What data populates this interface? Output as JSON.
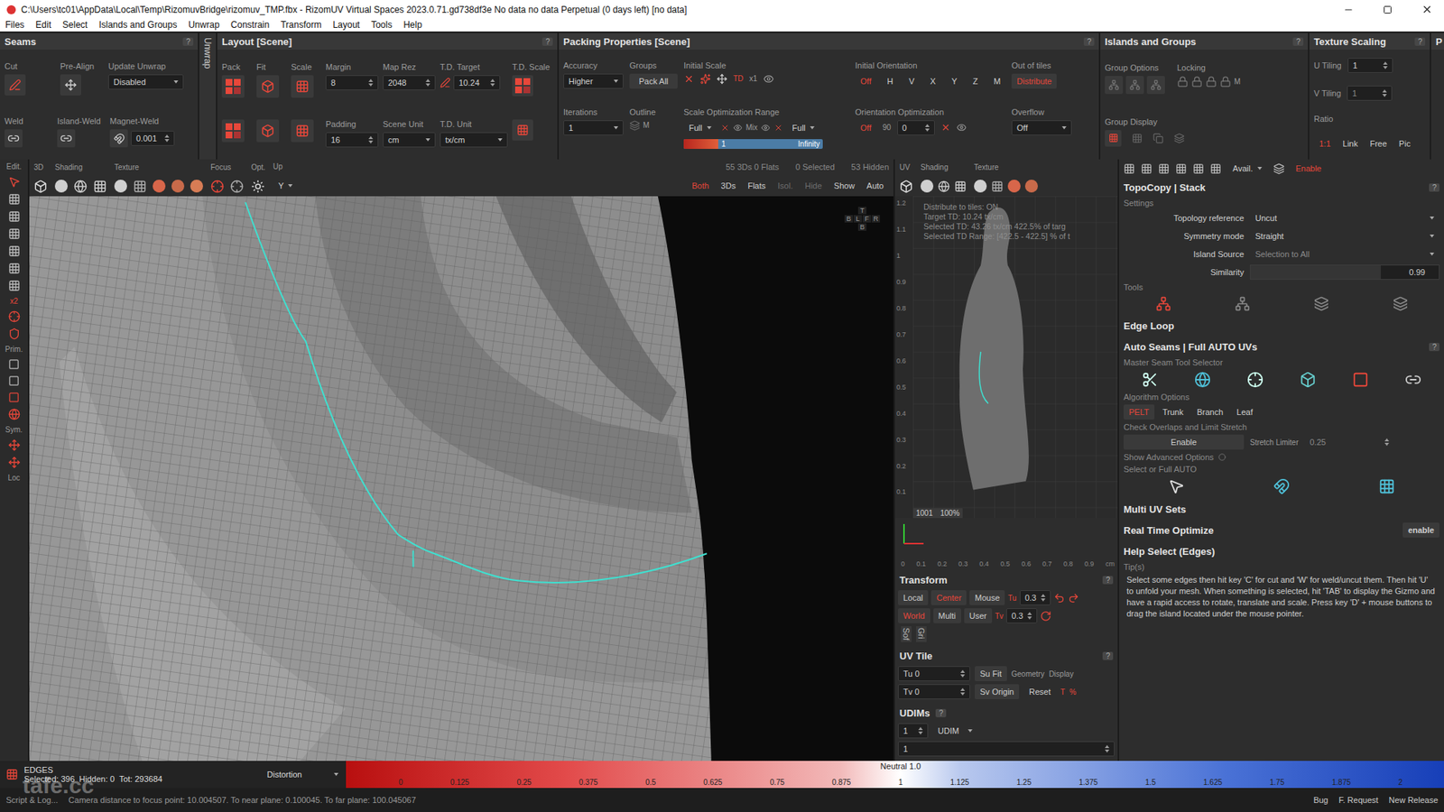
{
  "window": {
    "title": "C:\\Users\\tc01\\AppData\\Local\\Temp\\RizomuvBridge\\rizomuv_TMP.fbx - RizomUV  Virtual Spaces 2023.0.71.gd738df3e No data no data Perpetual  (0 days left) [no data]"
  },
  "menu": [
    "Files",
    "Edit",
    "Select",
    "Islands and Groups",
    "Unwrap",
    "Constrain",
    "Transform",
    "Layout",
    "Tools",
    "Help"
  ],
  "seams": {
    "title": "Seams",
    "help": "?",
    "cut": "Cut",
    "preAlign": "Pre-Align",
    "updateUnwrap": "Update Unwrap",
    "updateValue": "Disabled",
    "weld": "Weld",
    "islandWeld": "Island-Weld",
    "magnetWeld": "Magnet-Weld",
    "magnetValue": "0.001"
  },
  "unwrapTab": "Unwrap",
  "layout": {
    "title": "Layout [Scene]",
    "help": "?",
    "pack": "Pack",
    "fit": "Fit",
    "scale": "Scale",
    "margin": {
      "label": "Margin",
      "value": "8"
    },
    "mapRez": {
      "label": "Map Rez",
      "value": "2048"
    },
    "tdTarget": {
      "label": "T.D. Target",
      "value": "10.24"
    },
    "tdScale": "T.D. Scale",
    "padding": {
      "label": "Padding",
      "value": "16"
    },
    "sceneUnit": {
      "label": "Scene Unit",
      "value": "cm"
    },
    "tdUnit": {
      "label": "T.D. Unit",
      "value": "tx/cm"
    }
  },
  "packing": {
    "title": "Packing Properties [Scene]",
    "help": "?",
    "accuracy": {
      "label": "Accuracy",
      "value": "Higher"
    },
    "groups": {
      "label": "Groups",
      "value": "Pack All"
    },
    "initialScale": {
      "label": "Initial Scale",
      "value": "x1"
    },
    "iterations": {
      "label": "Iterations",
      "value": "1"
    },
    "outline": {
      "label": "Outline",
      "value": "M"
    },
    "scaleRange": {
      "label": "Scale Optimization Range",
      "min": "Full",
      "mix": "Mix",
      "max": "Full",
      "low": "1",
      "high": "Infinity",
      "level": 0.5
    },
    "initialOrientation": {
      "label": "Initial Orientation",
      "off": "Off",
      "axes": [
        "H",
        "V",
        "X",
        "Y",
        "Z",
        "M"
      ]
    },
    "orientationOpt": {
      "label": "Orientation Optimization",
      "off": "Off",
      "step": "90",
      "value": "0"
    },
    "outOfTiles": {
      "label": "Out of tiles",
      "value": "Distribute"
    },
    "overflow": {
      "label": "Overflow",
      "value": "Off"
    }
  },
  "islands": {
    "title": "Islands and Groups",
    "help": "?",
    "groupOptions": "Group Options",
    "locking": "Locking",
    "lockM": "M",
    "groupDisplay": "Group Display"
  },
  "texScaling": {
    "title": "Texture Scaling",
    "help": "?",
    "uTiling": {
      "label": "U Tiling",
      "value": "1"
    },
    "vTiling": {
      "label": "V Tiling",
      "value": "1"
    },
    "ratio": {
      "label": "Ratio",
      "options": [
        {
          "label": "1:1",
          "selected": true
        },
        {
          "label": "Link",
          "selected": false
        },
        {
          "label": "Free",
          "selected": false
        },
        {
          "label": "Pic",
          "selected": false
        }
      ]
    }
  },
  "cutPanel": "P",
  "leftToolbar": {
    "edit": "Edit.",
    "x2": "x2",
    "prim": "Prim.",
    "sym": "Sym.",
    "loc": "Loc"
  },
  "viewport": {
    "labels": [
      "3D",
      "Shading",
      "Texture",
      "Focus",
      "Opt.",
      "Up"
    ],
    "upValue": "Y",
    "stats": [
      "55 3Ds 0 Flats",
      "0 Selected",
      "53 Hidden"
    ],
    "buttons": [
      {
        "label": "Both",
        "selected": true,
        "disabled": false
      },
      {
        "label": "3Ds",
        "selected": false,
        "disabled": false
      },
      {
        "label": "Flats",
        "selected": false,
        "disabled": false
      },
      {
        "label": "Isol.",
        "selected": false,
        "disabled": true
      },
      {
        "label": "Hide",
        "selected": false,
        "disabled": true
      },
      {
        "label": "Show",
        "selected": false,
        "disabled": false
      },
      {
        "label": "Auto",
        "selected": false,
        "disabled": false
      }
    ],
    "cube": {
      "top": "T",
      "middle": [
        "B",
        "L",
        "F",
        "R"
      ],
      "bottom": "B"
    }
  },
  "uv": {
    "labels": [
      "UV",
      "Shading",
      "Texture"
    ],
    "info": [
      "Distribute to tiles: ON",
      "Target TD: 10.24 tx/cm",
      "Selected TD: 43.26 tx/cm 422.5% of targ",
      "Selected TD Range: [422.5 - 422.5] % of t"
    ],
    "yTicks": [
      "1.2",
      "1.1",
      "1",
      "0.9",
      "0.8",
      "0.7",
      "0.6",
      "0.5",
      "0.4",
      "0.3",
      "0.2",
      "0.1"
    ],
    "tile": "1001",
    "zoom": "100%",
    "xTicks": [
      "0",
      "0.1",
      "0.2",
      "0.3",
      "0.4",
      "0.5",
      "0.6",
      "0.7",
      "0.8",
      "0.9"
    ],
    "unit": "cm"
  },
  "transform": {
    "title": "Transform",
    "help": "?",
    "row1": [
      {
        "label": "Local",
        "selected": false
      },
      {
        "label": "Center",
        "selected": true
      },
      {
        "label": "Mouse",
        "selected": false
      }
    ],
    "row2": [
      {
        "label": "World",
        "selected": true
      },
      {
        "label": "Multi",
        "selected": false
      },
      {
        "label": "User",
        "selected": false
      }
    ],
    "tu": {
      "label": "Tu",
      "value": "0.3"
    },
    "tv": {
      "label": "Tv",
      "value": "0.3"
    },
    "side": [
      "Sof",
      "Gri"
    ]
  },
  "uvTile": {
    "title": "UV Tile",
    "help": "?",
    "tu": "Tu 0",
    "tv": "Tv 0",
    "suFit": "Su Fit",
    "svOrigin": "Sv Origin",
    "geometry": "Geometry",
    "display": "Display",
    "reset": "Reset",
    "t": "T",
    "pct": "%"
  },
  "udims": {
    "title": "UDIMs",
    "help": "?",
    "u": "1",
    "v": "1",
    "mode": "UDIM"
  },
  "right": {
    "avail": "Avail.",
    "enable": "Enable",
    "topo": {
      "title": "TopoCopy | Stack",
      "help": "?",
      "settings": "Settings",
      "rows": [
        {
          "label": "Topology reference",
          "value": "Uncut",
          "disabled": false
        },
        {
          "label": "Symmetry mode",
          "value": "Straight",
          "disabled": false
        },
        {
          "label": "Island Source",
          "value": "Selection to All",
          "disabled": true
        }
      ],
      "similarity": {
        "label": "Similarity",
        "value": "0.99",
        "level": 0.99
      },
      "tools": "Tools"
    },
    "edgeLoop": "Edge Loop",
    "auto": {
      "title": "Auto Seams | Full AUTO UVs",
      "help": "?",
      "master": "Master Seam Tool Selector",
      "algorithm": "Algorithm Options",
      "algos": [
        {
          "label": "PELT",
          "selected": true
        },
        {
          "label": "Trunk",
          "selected": false
        },
        {
          "label": "Branch",
          "selected": false
        },
        {
          "label": "Leaf",
          "selected": false
        }
      ],
      "check": "Check Overlaps and Limit Stretch",
      "enable": "Enable",
      "stretch": {
        "label": "Stretch Limiter",
        "value": "0.25"
      },
      "advanced": "Show Advanced Options",
      "selectAuto": "Select or Full AUTO"
    },
    "multiUV": "Multi UV Sets",
    "realTime": {
      "label": "Real Time Optimize",
      "button": "enable"
    },
    "help": {
      "title": "Help Select (Edges)",
      "tips": "Tip(s)",
      "text": "Select some edges then hit key 'C' for cut and 'W' for weld/uncut them. Then hit 'U' to unfold your mesh. When something is selected, hit 'TAB' to display the Gizmo and have a rapid access to rotate, translate and scale. Press key 'D' + mouse buttons to drag the island located under the mouse pointer."
    }
  },
  "status": {
    "mode": "EDGES",
    "selected": "Selected: 396",
    "hidden": "Hidden: 0",
    "total": "Tot: 293684",
    "distortion": "Distortion",
    "neutral": "Neutral 1.0",
    "ticks": [
      "0",
      "0.125",
      "0.25",
      "0.375",
      "0.5",
      "0.625",
      "0.75",
      "0.875",
      "1",
      "1.125",
      "1.25",
      "1.375",
      "1.5",
      "1.625",
      "1.75",
      "1.875",
      "2"
    ]
  },
  "footer": {
    "script": "Script & Log...",
    "message": "Camera distance to focus point: 10.004507. To near plane: 0.100045. To far plane: 100.045067",
    "links": [
      "Bug",
      "F. Request",
      "New Release"
    ]
  },
  "watermark": "tafe.cc"
}
